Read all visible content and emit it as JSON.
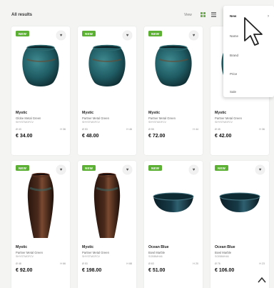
{
  "header": {
    "results_label": "All results",
    "view_label": "View",
    "grid_icon": "grid-icon",
    "list_icon": "list-icon"
  },
  "sort_dropdown": {
    "items": [
      {
        "label": "New",
        "selected": true
      },
      {
        "label": "Name",
        "selected": false
      },
      {
        "label": "Brand",
        "selected": false
      },
      {
        "label": "Price",
        "selected": false
      },
      {
        "label": "Sale",
        "selected": false
      }
    ]
  },
  "products": [
    {
      "badge": "NEW",
      "name": "Mystic",
      "subtitle": "Globe Metal Green",
      "code": "SHYSTMGFCV",
      "dim_left": "Ø 43",
      "dim_right": "H 36",
      "price": "€ 34.00",
      "shape": "round",
      "color": "#1f5b63"
    },
    {
      "badge": "NEW",
      "name": "Mystic",
      "subtitle": "Partner Metal Green",
      "code": "SHYSTMGFCV",
      "dim_left": "Ø 53",
      "dim_right": "H 46",
      "price": "€ 48.00",
      "shape": "round",
      "color": "#1f5b63"
    },
    {
      "badge": "NEW",
      "name": "Mystic",
      "subtitle": "Partner Metal Green",
      "code": "SHYSTMGFCV",
      "dim_left": "Ø 55",
      "dim_right": "H 44",
      "price": "€ 72.00",
      "shape": "round",
      "color": "#1f5b63"
    },
    {
      "badge": "",
      "name": "Mystic",
      "subtitle": "Partner Metal Green",
      "code": "SHYSTMGFCV",
      "dim_left": "Ø 45",
      "dim_right": "H 36",
      "price": "€ 42.00",
      "shape": "round",
      "color": "#1f5b63"
    },
    {
      "badge": "NEW",
      "name": "Mystic",
      "subtitle": "Partner Metal Green",
      "code": "SHYSTMGFCV",
      "dim_left": "Ø 48",
      "dim_right": "H 66",
      "price": "€ 92.00",
      "shape": "tall",
      "color": "#4a2a1c"
    },
    {
      "badge": "NEW",
      "name": "Mystic",
      "subtitle": "Partner Metal Green",
      "code": "SHYSTMGFCV",
      "dim_left": "Ø 53",
      "dim_right": "H 88",
      "price": "€ 198.00",
      "shape": "tall",
      "color": "#4a2a1c"
    },
    {
      "badge": "NEW",
      "name": "Ocean Blue",
      "subtitle": "Bowl Marble",
      "code": "SOBBMH46",
      "dim_left": "Ø 63",
      "dim_right": "H 20",
      "price": "€ 51.00",
      "shape": "bowl",
      "color": "#163a47"
    },
    {
      "badge": "NEW",
      "name": "Ocean Blue",
      "subtitle": "Bowl Marble",
      "code": "SOBBMH46",
      "dim_left": "Ø 76",
      "dim_right": "H 23",
      "price": "€ 106.00",
      "shape": "bowl",
      "color": "#163a47"
    }
  ],
  "colors": {
    "badge": "#5cb034",
    "accent": "#6bb04a",
    "background": "#f4f5f3"
  },
  "icons": {
    "favorite": "heart-icon",
    "cursor": "mouse-pointer-icon",
    "scroll_top": "chevron-up-icon"
  }
}
